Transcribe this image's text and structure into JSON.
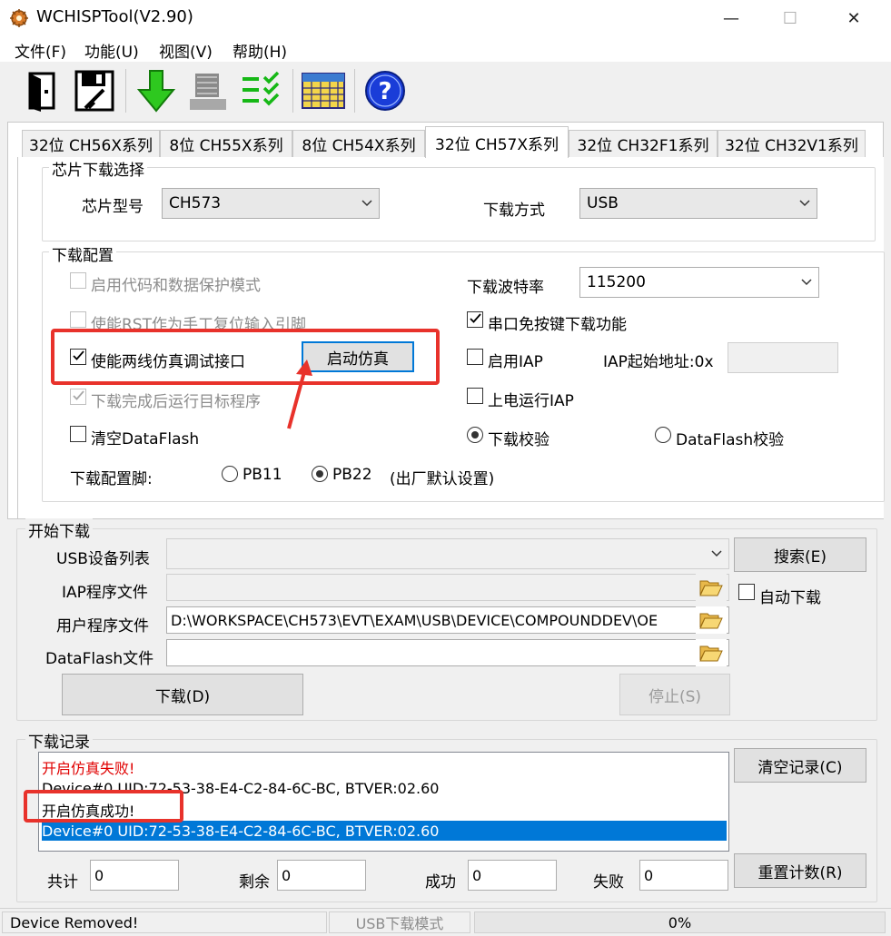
{
  "window": {
    "title": "WCHISPTool(V2.90)",
    "minimize": "—",
    "maximize": "☐",
    "close": "✕"
  },
  "menu": [
    "文件(F)",
    "功能(U)",
    "视图(V)",
    "帮助(H)"
  ],
  "tabs": [
    "32位 CH56X系列",
    "8位 CH55X系列",
    "8位 CH54X系列",
    "32位 CH57X系列",
    "32位 CH32F1系列",
    "32位 CH32V1系列"
  ],
  "active_tab": 3,
  "chip_select": {
    "title": "芯片下载选择",
    "chip_label": "芯片型号",
    "chip_value": "CH573",
    "mode_label": "下载方式",
    "mode_value": "USB"
  },
  "config": {
    "title": "下载配置",
    "protect_mode": "启用代码和数据保护模式",
    "rst_pin": "使能RST作为手工复位输入引脚",
    "two_wire": "使能两线仿真调试接口",
    "start_sim_button": "启动仿真",
    "run_after": "下载完成后运行目标程序",
    "clear_dataflash": "清空DataFlash",
    "pin_label": "下载配置脚:",
    "pin_pb11": "PB11",
    "pin_pb22": "PB22",
    "pin_note": "(出厂默认设置)",
    "baud_label": "下载波特率",
    "baud_value": "115200",
    "serial_keyfree": "串口免按键下载功能",
    "enable_iap": "启用IAP",
    "iap_addr_label": "IAP起始地址:0x",
    "iap_addr_value": "",
    "power_run_iap": "上电运行IAP",
    "verify_download": "下载校验",
    "verify_dataflash": "DataFlash校验"
  },
  "download": {
    "title": "开始下载",
    "usb_list_label": "USB设备列表",
    "usb_list_value": "",
    "iap_file_label": "IAP程序文件",
    "iap_file_value": "",
    "user_file_label": "用户程序文件",
    "user_file_value": "D:\\WORKSPACE\\CH573\\EVT\\EXAM\\USB\\DEVICE\\COMPOUNDDEV\\OE",
    "dataflash_label": "DataFlash文件",
    "dataflash_value": "",
    "search_button": "搜索(E)",
    "auto_download": "自动下载",
    "download_button": "下载(D)",
    "stop_button": "停止(S)"
  },
  "log": {
    "title": "下载记录",
    "lines": [
      "开启仿真失败!",
      "Device#0  UID:72-53-38-E4-C2-84-6C-BC, BTVER:02.60",
      "开启仿真成功!",
      "Device#0  UID:72-53-38-E4-C2-84-6C-BC, BTVER:02.60"
    ],
    "clear_button": "清空记录(C)",
    "reset_button": "重置计数(R)",
    "total_label": "共计",
    "total_value": "0",
    "remain_label": "剩余",
    "remain_value": "0",
    "success_label": "成功",
    "success_value": "0",
    "fail_label": "失败",
    "fail_value": "0"
  },
  "status": {
    "message": "Device Removed!",
    "mode": "USB下载模式",
    "progress": "0%",
    "progress_fraction": 0
  },
  "colors": {
    "accent": "#0078d7",
    "annotation_red": "#e8322b",
    "error_text": "#e00000"
  }
}
